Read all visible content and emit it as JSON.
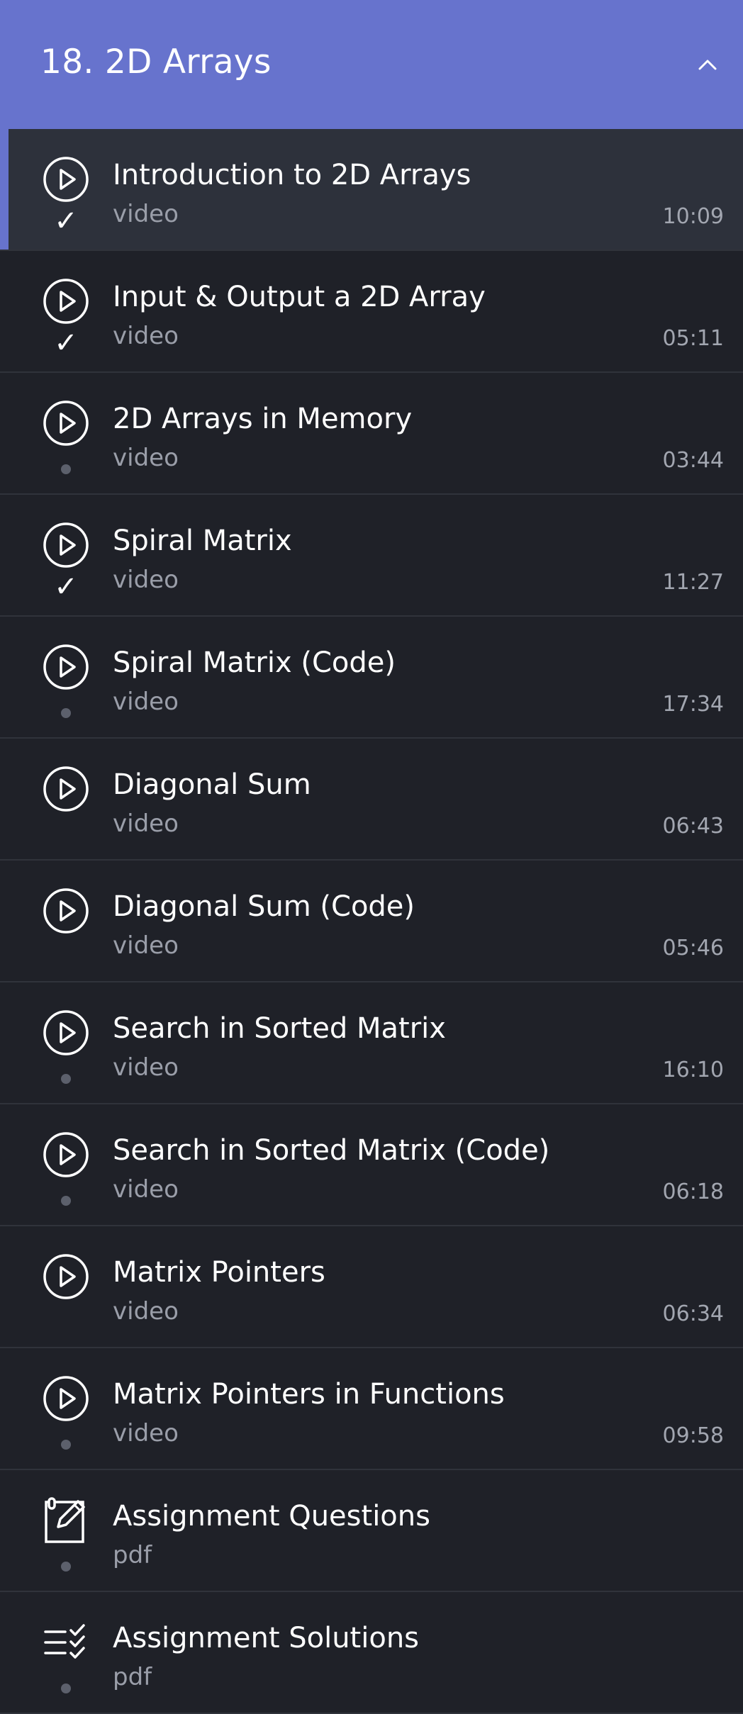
{
  "section": {
    "title": "18. 2D Arrays",
    "expanded": true,
    "accent_color": "#6773cd"
  },
  "items": [
    {
      "title": "Introduction to 2D Arrays",
      "type": "video",
      "duration": "10:09",
      "icon": "play-circle-icon",
      "status": "completed",
      "active": true
    },
    {
      "title": "Input & Output a 2D Array",
      "type": "video",
      "duration": "05:11",
      "icon": "play-circle-icon",
      "status": "completed",
      "active": false
    },
    {
      "title": "2D Arrays in Memory",
      "type": "video",
      "duration": "03:44",
      "icon": "play-circle-icon",
      "status": "incomplete",
      "active": false
    },
    {
      "title": "Spiral Matrix",
      "type": "video",
      "duration": "11:27",
      "icon": "play-circle-icon",
      "status": "completed",
      "active": false
    },
    {
      "title": "Spiral Matrix (Code)",
      "type": "video",
      "duration": "17:34",
      "icon": "play-circle-icon",
      "status": "incomplete",
      "active": false
    },
    {
      "title": "Diagonal Sum",
      "type": "video",
      "duration": "06:43",
      "icon": "play-circle-icon",
      "status": "none",
      "active": false
    },
    {
      "title": "Diagonal Sum (Code)",
      "type": "video",
      "duration": "05:46",
      "icon": "play-circle-icon",
      "status": "none",
      "active": false
    },
    {
      "title": "Search in Sorted Matrix",
      "type": "video",
      "duration": "16:10",
      "icon": "play-circle-icon",
      "status": "incomplete",
      "active": false
    },
    {
      "title": "Search in Sorted Matrix (Code)",
      "type": "video",
      "duration": "06:18",
      "icon": "play-circle-icon",
      "status": "incomplete",
      "active": false
    },
    {
      "title": "Matrix Pointers",
      "type": "video",
      "duration": "06:34",
      "icon": "play-circle-icon",
      "status": "none",
      "active": false
    },
    {
      "title": "Matrix Pointers in Functions",
      "type": "video",
      "duration": "09:58",
      "icon": "play-circle-icon",
      "status": "incomplete",
      "active": false
    },
    {
      "title": "Assignment Questions",
      "type": "pdf",
      "duration": "",
      "icon": "edit-document-icon",
      "status": "incomplete",
      "active": false
    },
    {
      "title": "Assignment Solutions",
      "type": "pdf",
      "duration": "",
      "icon": "checklist-icon",
      "status": "incomplete",
      "active": false
    }
  ]
}
